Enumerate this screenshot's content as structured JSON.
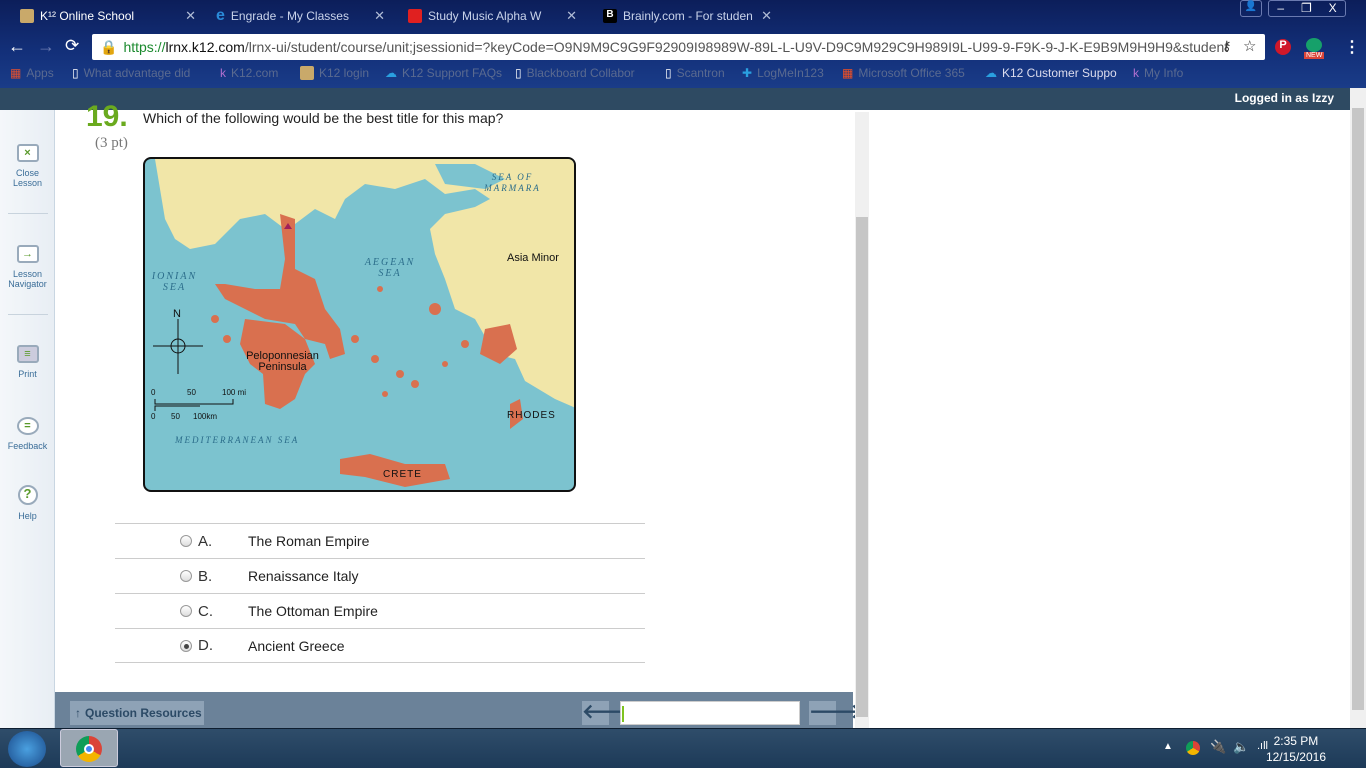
{
  "browser": {
    "tabs": [
      {
        "title": "K¹² Online School",
        "active": true
      },
      {
        "title": "Engrade - My Classes",
        "active": false
      },
      {
        "title": "Study Music Alpha W",
        "active": false
      },
      {
        "title": "Brainly.com - For studen",
        "active": false
      }
    ],
    "url_scheme": "https://",
    "url_host": "lrnx.k12.com",
    "url_path": "/lrnx-ui/student/course/unit;jsessionid=?keyCode=O9N9M9C9G9F92909I98989W-89L-L-U9V-D9C9M929C9H989I9L-U99-9-F9K-9-J-K-E9B9M9H9H9&student",
    "bookmarks": [
      "Apps",
      "What advantage did",
      "K12.com",
      "K12 login",
      "K12 Support FAQs",
      "Blackboard Collabor",
      "Scantron",
      "LogMeIn123",
      "Microsoft Office 365",
      "K12 Customer Suppo",
      "My Info"
    ],
    "new_badge": "NEW"
  },
  "header": {
    "logged_in": "Logged in as Izzy"
  },
  "sidebar": {
    "items": [
      {
        "label1": "Close",
        "label2": "Lesson",
        "icon": "close-lesson-icon"
      },
      {
        "label1": "Lesson",
        "label2": "Navigator",
        "icon": "navigator-icon"
      },
      {
        "label1": "Print",
        "label2": "",
        "icon": "printer-icon"
      },
      {
        "label1": "Feedback",
        "label2": "",
        "icon": "speech-bubble-icon"
      },
      {
        "label1": "Help",
        "label2": "",
        "icon": "help-icon"
      }
    ]
  },
  "question": {
    "number": "19.",
    "text": "Which of the following would be the best title for this map?",
    "points": "(3 pt)",
    "map": {
      "labels": {
        "marmara": "SEA OF MARMARA",
        "aegean": "AEGEAN SEA",
        "ionian": "IONIAN SEA",
        "asia": "Asia Minor",
        "pelop": "Peloponnesian Peninsula",
        "med": "MEDITERRANEAN SEA",
        "rhodes": "RHODES",
        "crete": "CRETE",
        "north": "N"
      },
      "scale": {
        "mi": [
          "0",
          "50",
          "100 mi"
        ],
        "km": [
          "0",
          "50",
          "100km"
        ]
      }
    },
    "options": [
      {
        "letter": "A.",
        "text": "The Roman Empire",
        "selected": false
      },
      {
        "letter": "B.",
        "text": "Renaissance Italy",
        "selected": false
      },
      {
        "letter": "C.",
        "text": "The Ottoman Empire",
        "selected": false
      },
      {
        "letter": "D.",
        "text": "Ancient Greece",
        "selected": true
      }
    ]
  },
  "footer": {
    "resources": "Question Resources",
    "progress_percent": 1
  },
  "taskbar": {
    "time": "2:35 PM",
    "date": "12/15/2016"
  },
  "colors": {
    "accent_green": "#6aaa1e",
    "header": "#2e4a62",
    "footer": "#6b8299",
    "sea": "#7cc3cf",
    "land": "#f1e6a8",
    "greece": "#d9704f"
  }
}
